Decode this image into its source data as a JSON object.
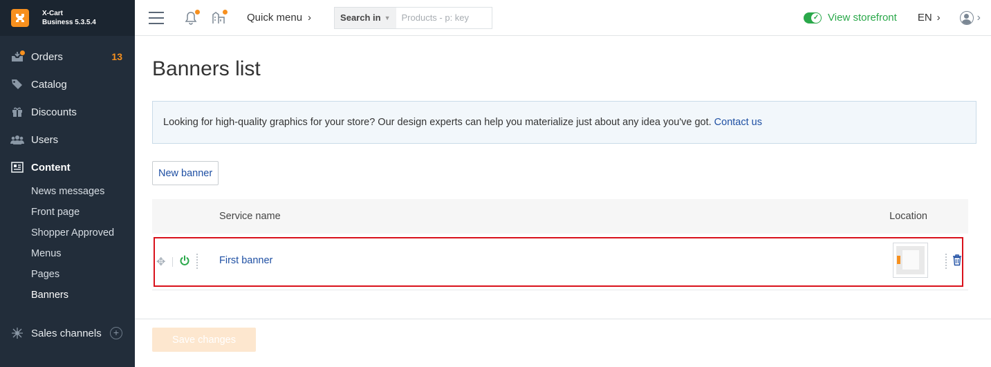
{
  "app": {
    "brand_line1": "X-Cart",
    "brand_line2": "Business 5.3.5.4"
  },
  "sidebar": {
    "items": [
      {
        "label": "Orders",
        "icon": "inbox-icon",
        "badge": "13"
      },
      {
        "label": "Catalog",
        "icon": "tags-icon"
      },
      {
        "label": "Discounts",
        "icon": "gift-icon"
      },
      {
        "label": "Users",
        "icon": "users-icon"
      },
      {
        "label": "Content",
        "icon": "newspaper-icon"
      }
    ],
    "content_sub": [
      "News messages",
      "Front page",
      "Shopper Approved",
      "Menus",
      "Pages",
      "Banners"
    ],
    "sales_channels": "Sales channels"
  },
  "topbar": {
    "quick_menu": "Quick menu",
    "search_in": "Search in",
    "search_placeholder": "Products - p: key",
    "view_storefront": "View storefront",
    "language": "EN"
  },
  "main": {
    "title": "Banners list",
    "promo_text": "Looking for high-quality graphics for your store? Our design experts can help you materialize just about any idea you've got.",
    "promo_link": "Contact us",
    "new_banner": "New banner",
    "columns": {
      "name": "Service name",
      "location": "Location"
    },
    "rows": [
      {
        "name": "First banner",
        "enabled": true
      }
    ],
    "save_changes": "Save changes"
  },
  "colors": {
    "accent": "#f7901e",
    "link": "#1e4fa3",
    "success": "#2aa84a",
    "highlight": "#d9111b",
    "sidebar_bg": "#222d3a"
  }
}
